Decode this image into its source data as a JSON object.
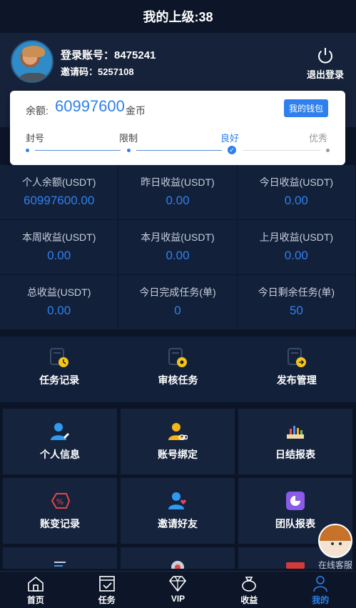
{
  "header": {
    "title": "我的上级:38"
  },
  "profile": {
    "account": "登录账号：8475241",
    "invite": "邀请码：5257108",
    "logout_label": "退出登录"
  },
  "balance": {
    "label": "余额:",
    "value": "60997600",
    "unit": "金币",
    "wallet_label": "我的钱包",
    "levels": [
      "封号",
      "限制",
      "良好",
      "优秀"
    ],
    "current_level": "良好"
  },
  "stats": [
    {
      "label": "个人余额(USDT)",
      "value": "60997600.00"
    },
    {
      "label": "昨日收益(USDT)",
      "value": "0.00"
    },
    {
      "label": "今日收益(USDT)",
      "value": "0.00"
    },
    {
      "label": "本周收益(USDT)",
      "value": "0.00"
    },
    {
      "label": "本月收益(USDT)",
      "value": "0.00"
    },
    {
      "label": "上月收益(USDT)",
      "value": "0.00"
    },
    {
      "label": "总收益(USDT)",
      "value": "0.00"
    },
    {
      "label": "今日完成任务(单)",
      "value": "0"
    },
    {
      "label": "今日剩余任务(单)",
      "value": "50"
    }
  ],
  "quick": [
    {
      "label": "任务记录",
      "icon": "task-record-icon"
    },
    {
      "label": "审核任务",
      "icon": "review-task-icon"
    },
    {
      "label": "发布管理",
      "icon": "publish-manage-icon"
    }
  ],
  "menu": [
    {
      "label": "个人信息",
      "icon": "user-edit-icon"
    },
    {
      "label": "账号绑定",
      "icon": "account-bind-icon"
    },
    {
      "label": "日结报表",
      "icon": "daily-report-icon"
    },
    {
      "label": "账变记录",
      "icon": "account-change-icon"
    },
    {
      "label": "邀请好友",
      "icon": "invite-friend-icon"
    },
    {
      "label": "团队报表",
      "icon": "team-report-icon"
    }
  ],
  "support": {
    "label": "在线客服"
  },
  "tabs": [
    {
      "label": "首页",
      "icon": "home-icon"
    },
    {
      "label": "任务",
      "icon": "task-icon"
    },
    {
      "label": "VIP",
      "icon": "diamond-icon"
    },
    {
      "label": "收益",
      "icon": "money-bag-icon"
    },
    {
      "label": "我的",
      "icon": "person-icon",
      "active": true
    }
  ],
  "colors": {
    "accent": "#2f80ed",
    "background": "#0b1527",
    "panel": "#13203a"
  }
}
